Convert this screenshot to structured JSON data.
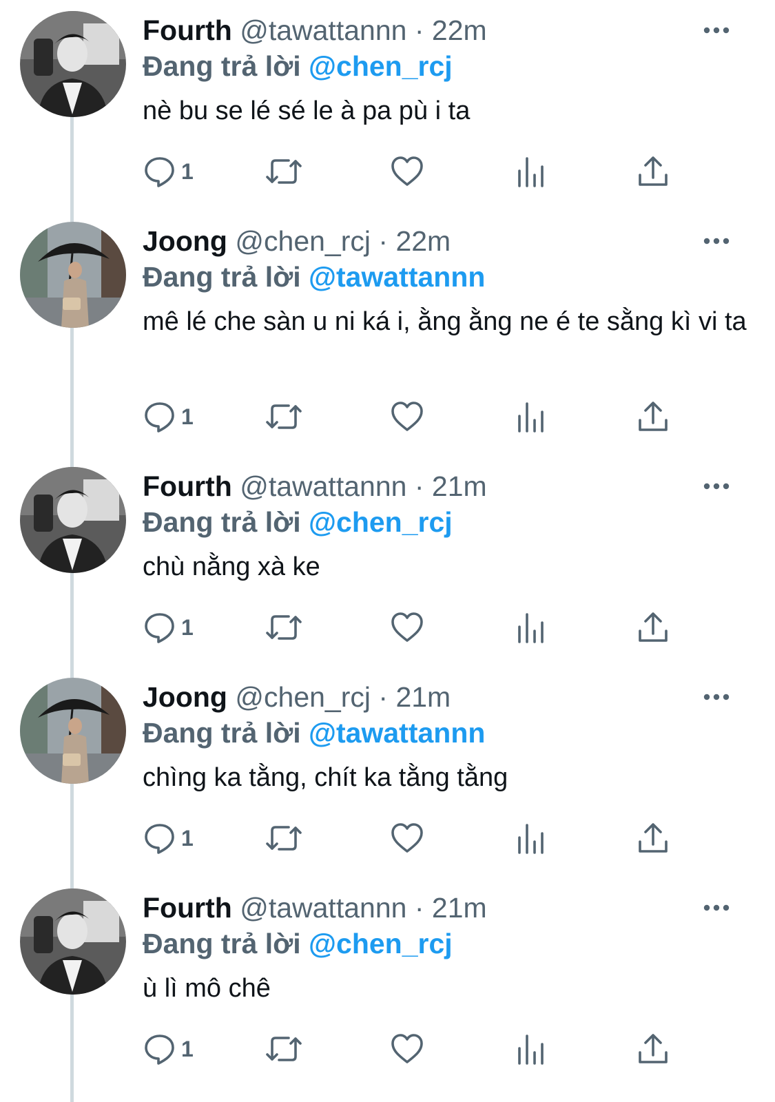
{
  "reply_prefix": "Đang trả lời",
  "tweets": [
    {
      "name": "Fourth",
      "handle": "@tawattannn",
      "sep": "·",
      "time": "22m",
      "reply_to": "@chen_rcj",
      "text": "nè bu se lé sé le à pa pù i ta",
      "reply_count": "1",
      "avatar": "fourth"
    },
    {
      "name": "Joong",
      "handle": "@chen_rcj",
      "sep": "·",
      "time": "22m",
      "reply_to": "@tawattannn",
      "text": "mê lé che sàn u ni ká i, ằng ằng ne é te sằng kì vi ta",
      "reply_count": "1",
      "avatar": "joong"
    },
    {
      "name": "Fourth",
      "handle": "@tawattannn",
      "sep": "·",
      "time": "21m",
      "reply_to": "@chen_rcj",
      "text": "chù nằng xà ke",
      "reply_count": "1",
      "avatar": "fourth"
    },
    {
      "name": "Joong",
      "handle": "@chen_rcj",
      "sep": "·",
      "time": "21m",
      "reply_to": "@tawattannn",
      "text": "chìng ka tằng, chít ka tằng tằng",
      "reply_count": "1",
      "avatar": "joong"
    },
    {
      "name": "Fourth",
      "handle": "@tawattannn",
      "sep": "·",
      "time": "21m",
      "reply_to": "@chen_rcj",
      "text": "ù lì mô chê",
      "reply_count": "1",
      "avatar": "fourth"
    }
  ],
  "icons": {
    "more": "more-horizontal-icon",
    "reply": "reply-bubble-icon",
    "retweet": "retweet-icon",
    "like": "heart-icon",
    "analytics": "analytics-bars-icon",
    "share": "share-upload-icon"
  },
  "colors": {
    "text_primary": "#0f1419",
    "text_secondary": "#536471",
    "mention": "#1d9bf0",
    "thread_line": "#cfd9de"
  }
}
